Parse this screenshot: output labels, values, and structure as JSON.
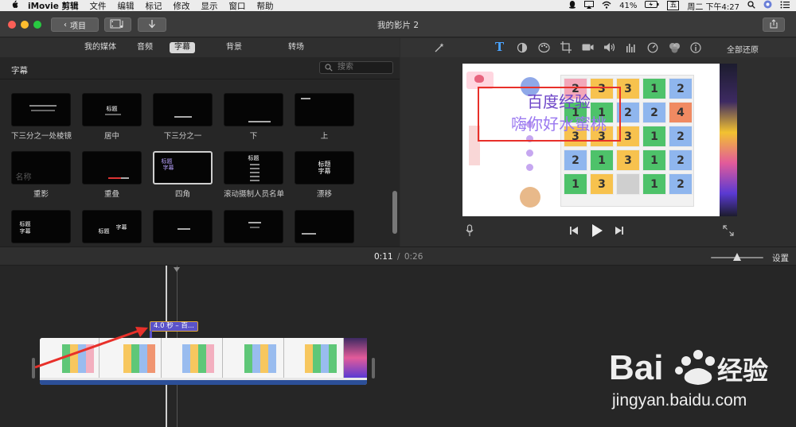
{
  "menubar": {
    "app": "iMovie 剪辑",
    "items": [
      "文件",
      "编辑",
      "标记",
      "修改",
      "显示",
      "窗口",
      "帮助"
    ],
    "battery": "41%",
    "input_method": "五",
    "clock": "周二 下午4:27"
  },
  "toolbar": {
    "back_label": "项目",
    "window_title": "我的影片 2"
  },
  "browser": {
    "tabs": [
      "我的媒体",
      "音频",
      "字幕",
      "背景",
      "转场"
    ],
    "active_tab": "字幕",
    "title": "字幕",
    "search_placeholder": "搜索",
    "titles_row1": [
      "下三分之一处棱镜",
      "居中",
      "下三分之一",
      "下",
      "上"
    ],
    "titles_row2": [
      "重影",
      "重叠",
      "四角",
      "滚动摄制人员名单",
      "漂移"
    ],
    "thumb_texts": {
      "center": "标题",
      "title": "标题",
      "subtitle": "字幕",
      "ghost": "名称"
    }
  },
  "viewer": {
    "reset_all": "全部还原",
    "title_main": "百度经验",
    "title_sub": "嗨你好水蜜桃"
  },
  "timebar": {
    "current": "0:11",
    "separator": "/",
    "total": "0:26",
    "settings": "设置"
  },
  "timeline": {
    "title_clip": "4.0 秒 – 百..."
  },
  "watermark": {
    "url": "jingyan.baidu.com"
  },
  "icons": [
    "apple-icon",
    "magic-wand-icon",
    "title-T-icon",
    "color-balance-icon",
    "palette-icon",
    "crop-icon",
    "camera-icon",
    "volume-icon",
    "equalizer-icon",
    "speed-icon",
    "filter-icon",
    "info-icon",
    "mic-icon",
    "skip-back-icon",
    "play-icon",
    "skip-forward-icon",
    "fullscreen-icon",
    "search-icon",
    "share-icon"
  ],
  "colors": {
    "selected_title": "#e0a93a",
    "clip_audio": "#2c4f98",
    "red_annotation": "#e8302a"
  }
}
